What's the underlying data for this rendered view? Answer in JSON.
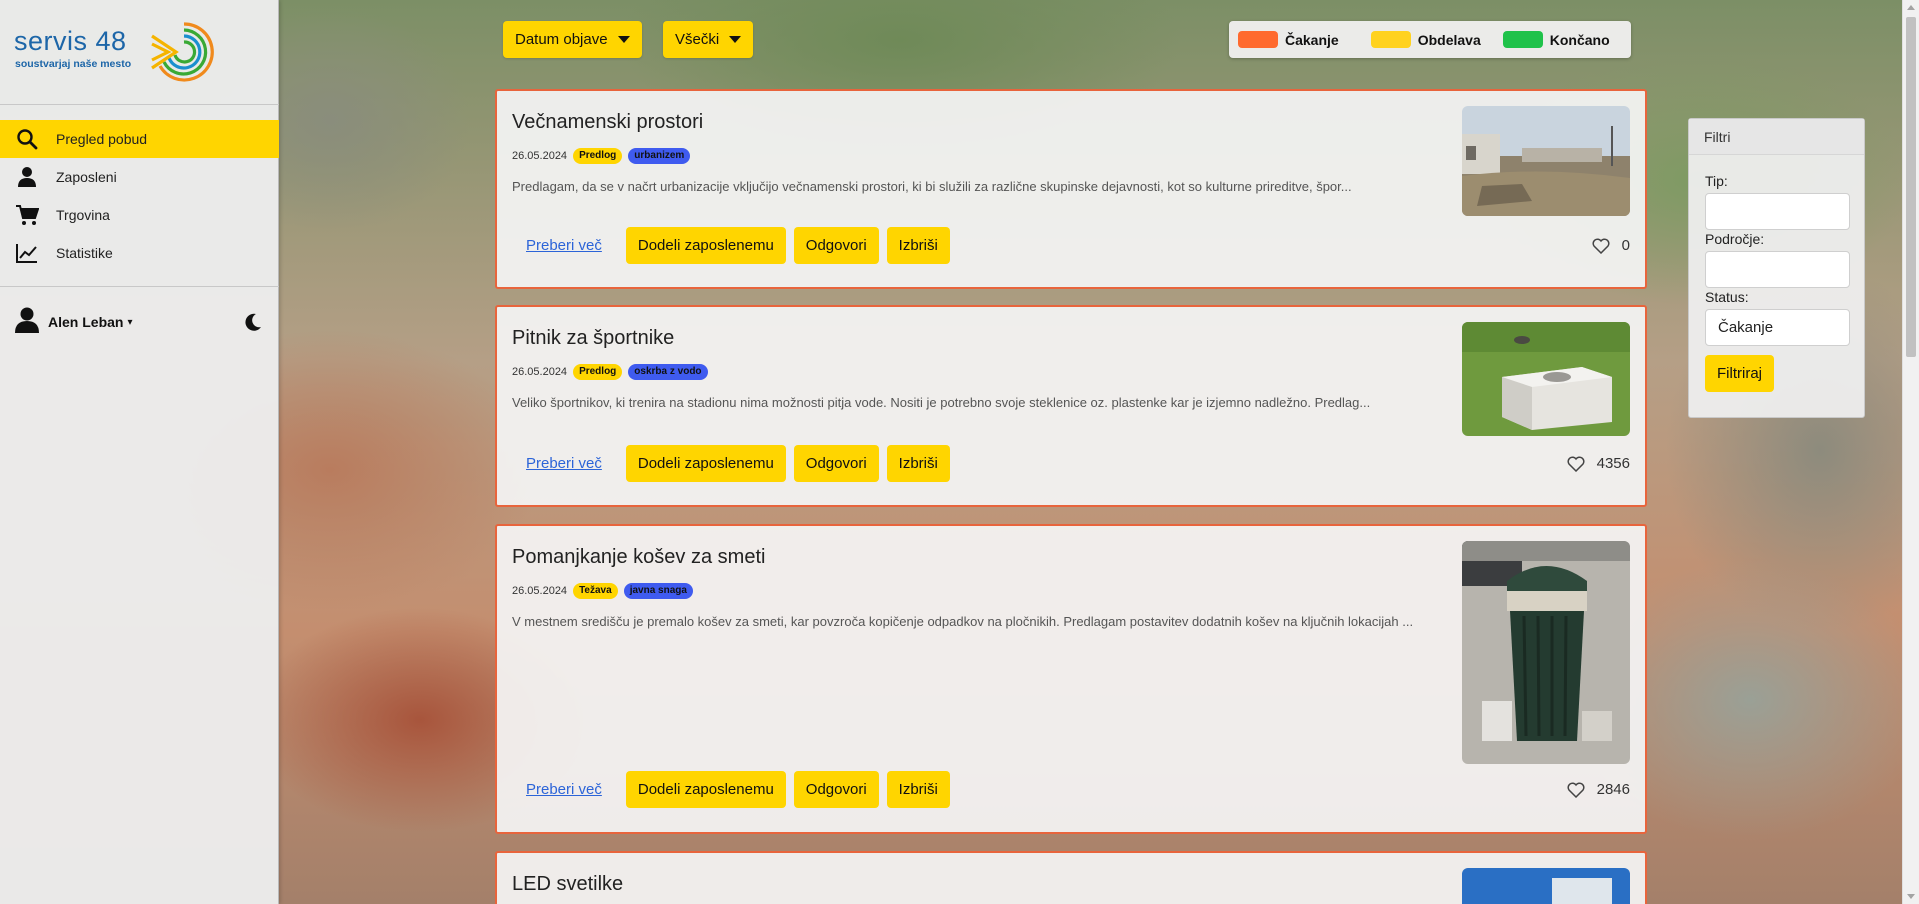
{
  "brand": {
    "name": "servis 48",
    "tagline": "soustvarjaj naše mesto",
    "ring_colors": [
      "#1a8fcf",
      "#39a935",
      "#f5b400",
      "#f08a1c"
    ]
  },
  "sidebar": {
    "items": [
      {
        "label": "Pregled pobud",
        "icon": "search-icon",
        "active": true
      },
      {
        "label": "Zaposleni",
        "icon": "user-icon",
        "active": false
      },
      {
        "label": "Trgovina",
        "icon": "cart-icon",
        "active": false
      },
      {
        "label": "Statistike",
        "icon": "chart-line-icon",
        "active": false
      }
    ],
    "user": {
      "name": "Alen Leban",
      "icon": "user-icon"
    },
    "theme_toggle_icon": "moon-icon"
  },
  "toolbar": {
    "sort_label": "Datum objave",
    "filter_label": "Všečki"
  },
  "legend": [
    {
      "label": "Čakanje",
      "color": "#ff6a2e"
    },
    {
      "label": "Obdelava",
      "color": "#ffd21f"
    },
    {
      "label": "Končano",
      "color": "#1fc24a"
    }
  ],
  "colors": {
    "accent": "#ffd500",
    "card_border": "#e8643c",
    "badge_category": "#3f5bef"
  },
  "actions": {
    "read_more": "Preberi več",
    "assign": "Dodeli zaposlenemu",
    "reply": "Odgovori",
    "delete": "Izbriši"
  },
  "cards": [
    {
      "title": "Večnamenski prostori",
      "date": "26.05.2024",
      "type": "Predlog",
      "category": "urbanizem",
      "description": "Predlagam, da se v načrt urbanizacije vključijo večnamenski prostori, ki bi služili za različne skupinske dejavnosti, kot so kulturne prireditve, špor...",
      "likes": "0",
      "image": "vacant-lot-photo"
    },
    {
      "title": "Pitnik za športnike",
      "date": "26.05.2024",
      "type": "Predlog",
      "category": "oskrba z vodo",
      "description": "Veliko športnikov, ki trenira na stadionu nima možnosti pitja vode. Nositi je potrebno svoje steklenice oz. plastenke kar je izjemno nadležno. Predlag...",
      "likes": "4356",
      "image": "drinking-fountain-photo"
    },
    {
      "title": "Pomanjkanje košev za smeti",
      "date": "26.05.2024",
      "type": "Težava",
      "category": "javna snaga",
      "description": "V mestnem središču je premalo košev za smeti, kar povzroča kopičenje odpadkov na pločnikih. Predlagam postavitev dodatnih košev na ključnih lokacijah ...",
      "likes": "2846",
      "image": "overflowing-trash-bin-photo"
    },
    {
      "title": "LED svetilke",
      "image": "street-light-photo"
    }
  ],
  "filters": {
    "title": "Filtri",
    "type_label": "Tip:",
    "type_value": "",
    "area_label": "Področje:",
    "area_value": "",
    "status_label": "Status:",
    "status_value": "Čakanje",
    "submit_label": "Filtriraj"
  }
}
